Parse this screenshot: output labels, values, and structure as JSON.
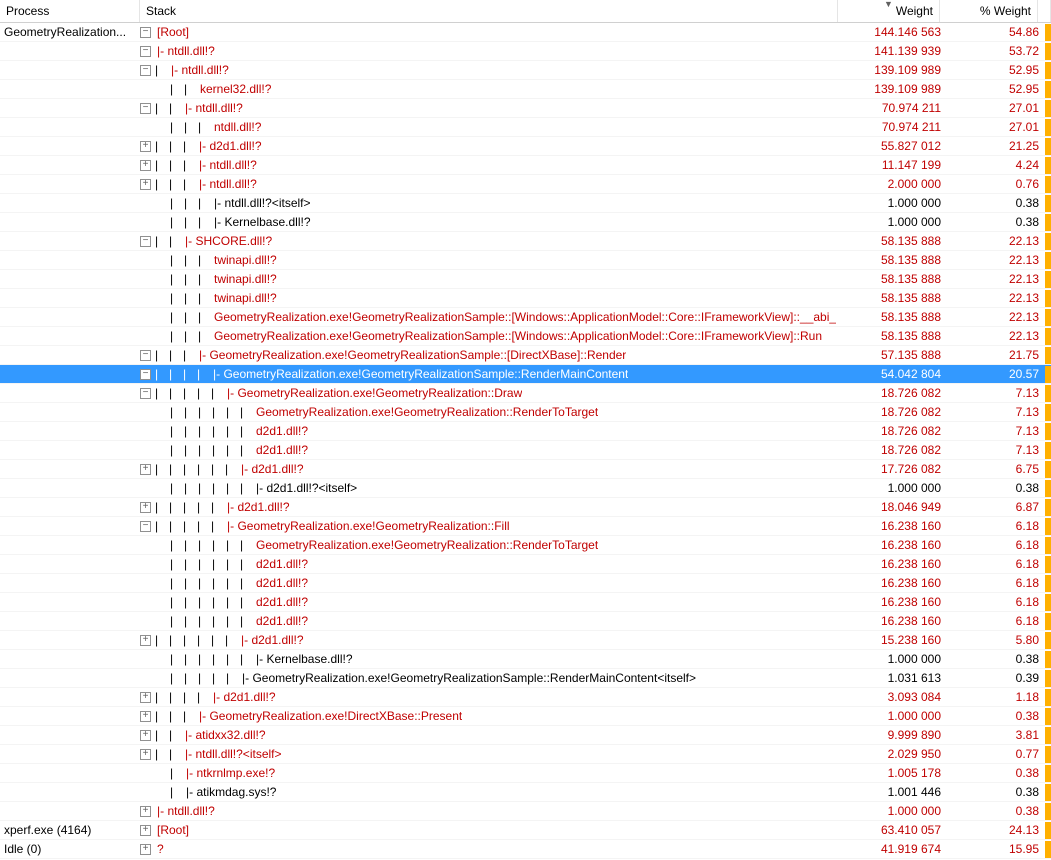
{
  "columns": {
    "process": "Process",
    "stack": "Stack",
    "weight": "Weight",
    "pweight": "% Weight"
  },
  "rows": [
    {
      "process": "GeometryRealization...",
      "expander": "-",
      "indent": 0,
      "pipes": 0,
      "label": "[Root]",
      "weight": "144.146 563",
      "pweight": "54.86",
      "color": "red",
      "bar": true
    },
    {
      "process": "",
      "expander": "-",
      "indent": 0,
      "pipes": 0,
      "label": "|- ntdll.dll!?",
      "weight": "141.139 939",
      "pweight": "53.72",
      "color": "red",
      "bar": true
    },
    {
      "process": "",
      "expander": "-",
      "indent": 0,
      "pipes": 1,
      "label": "|- ntdll.dll!?",
      "weight": "139.109 989",
      "pweight": "52.95",
      "color": "red",
      "bar": true
    },
    {
      "process": "",
      "expander": "",
      "indent": 1,
      "pipes": 2,
      "label": "kernel32.dll!?",
      "weight": "139.109 989",
      "pweight": "52.95",
      "color": "red",
      "bar": true
    },
    {
      "process": "",
      "expander": "-",
      "indent": 0,
      "pipes": 2,
      "label": "|- ntdll.dll!?",
      "weight": "70.974 211",
      "pweight": "27.01",
      "color": "red",
      "bar": true
    },
    {
      "process": "",
      "expander": "",
      "indent": 1,
      "pipes": 3,
      "label": "ntdll.dll!?",
      "weight": "70.974 211",
      "pweight": "27.01",
      "color": "red",
      "bar": true
    },
    {
      "process": "",
      "expander": "+",
      "indent": 0,
      "pipes": 3,
      "label": "|- d2d1.dll!?",
      "weight": "55.827 012",
      "pweight": "21.25",
      "color": "red",
      "bar": true
    },
    {
      "process": "",
      "expander": "+",
      "indent": 0,
      "pipes": 3,
      "label": "|- ntdll.dll!?",
      "weight": "11.147 199",
      "pweight": "4.24",
      "color": "red",
      "bar": true
    },
    {
      "process": "",
      "expander": "+",
      "indent": 0,
      "pipes": 3,
      "label": "|- ntdll.dll!?",
      "weight": "2.000 000",
      "pweight": "0.76",
      "color": "red",
      "bar": true
    },
    {
      "process": "",
      "expander": "",
      "indent": 1,
      "pipes": 3,
      "label": "|- ntdll.dll!?<itself>",
      "weight": "1.000 000",
      "pweight": "0.38",
      "color": "black",
      "bar": true
    },
    {
      "process": "",
      "expander": "",
      "indent": 1,
      "pipes": 3,
      "label": "|- Kernelbase.dll!?",
      "weight": "1.000 000",
      "pweight": "0.38",
      "color": "black",
      "bar": true
    },
    {
      "process": "",
      "expander": "-",
      "indent": 0,
      "pipes": 2,
      "label": "|- SHCORE.dll!?",
      "weight": "58.135 888",
      "pweight": "22.13",
      "color": "red",
      "bar": true
    },
    {
      "process": "",
      "expander": "",
      "indent": 1,
      "pipes": 3,
      "label": "twinapi.dll!?",
      "weight": "58.135 888",
      "pweight": "22.13",
      "color": "red",
      "bar": true
    },
    {
      "process": "",
      "expander": "",
      "indent": 1,
      "pipes": 3,
      "label": "twinapi.dll!?",
      "weight": "58.135 888",
      "pweight": "22.13",
      "color": "red",
      "bar": true
    },
    {
      "process": "",
      "expander": "",
      "indent": 1,
      "pipes": 3,
      "label": "twinapi.dll!?",
      "weight": "58.135 888",
      "pweight": "22.13",
      "color": "red",
      "bar": true
    },
    {
      "process": "",
      "expander": "",
      "indent": 1,
      "pipes": 3,
      "label": "GeometryRealization.exe!GeometryRealizationSample::[Windows::ApplicationModel::Core::IFrameworkView]::__abi_",
      "weight": "58.135 888",
      "pweight": "22.13",
      "color": "red",
      "bar": true
    },
    {
      "process": "",
      "expander": "",
      "indent": 1,
      "pipes": 3,
      "label": "GeometryRealization.exe!GeometryRealizationSample::[Windows::ApplicationModel::Core::IFrameworkView]::Run",
      "weight": "58.135 888",
      "pweight": "22.13",
      "color": "red",
      "bar": true
    },
    {
      "process": "",
      "expander": "-",
      "indent": 0,
      "pipes": 3,
      "label": "|- GeometryRealization.exe!GeometryRealizationSample::[DirectXBase]::Render",
      "weight": "57.135 888",
      "pweight": "21.75",
      "color": "red",
      "bar": true
    },
    {
      "process": "",
      "expander": "-",
      "indent": 0,
      "pipes": 4,
      "label": "|- GeometryRealization.exe!GeometryRealizationSample::RenderMainContent",
      "weight": "54.042 804",
      "pweight": "20.57",
      "color": "red",
      "bar": true,
      "selected": true
    },
    {
      "process": "",
      "expander": "-",
      "indent": 0,
      "pipes": 5,
      "label": "|- GeometryRealization.exe!GeometryRealization::Draw",
      "weight": "18.726 082",
      "pweight": "7.13",
      "color": "red",
      "bar": true
    },
    {
      "process": "",
      "expander": "",
      "indent": 1,
      "pipes": 6,
      "label": "GeometryRealization.exe!GeometryRealization::RenderToTarget",
      "weight": "18.726 082",
      "pweight": "7.13",
      "color": "red",
      "bar": true
    },
    {
      "process": "",
      "expander": "",
      "indent": 1,
      "pipes": 6,
      "label": "d2d1.dll!?",
      "weight": "18.726 082",
      "pweight": "7.13",
      "color": "red",
      "bar": true
    },
    {
      "process": "",
      "expander": "",
      "indent": 1,
      "pipes": 6,
      "label": "d2d1.dll!?",
      "weight": "18.726 082",
      "pweight": "7.13",
      "color": "red",
      "bar": true
    },
    {
      "process": "",
      "expander": "+",
      "indent": 0,
      "pipes": 6,
      "label": "|- d2d1.dll!?",
      "weight": "17.726 082",
      "pweight": "6.75",
      "color": "red",
      "bar": true
    },
    {
      "process": "",
      "expander": "",
      "indent": 1,
      "pipes": 6,
      "label": "|- d2d1.dll!?<itself>",
      "weight": "1.000 000",
      "pweight": "0.38",
      "color": "black",
      "bar": true
    },
    {
      "process": "",
      "expander": "+",
      "indent": 0,
      "pipes": 5,
      "label": "|- d2d1.dll!?",
      "weight": "18.046 949",
      "pweight": "6.87",
      "color": "red",
      "bar": true
    },
    {
      "process": "",
      "expander": "-",
      "indent": 0,
      "pipes": 5,
      "label": "|- GeometryRealization.exe!GeometryRealization::Fill",
      "weight": "16.238 160",
      "pweight": "6.18",
      "color": "red",
      "bar": true
    },
    {
      "process": "",
      "expander": "",
      "indent": 1,
      "pipes": 6,
      "label": "GeometryRealization.exe!GeometryRealization::RenderToTarget",
      "weight": "16.238 160",
      "pweight": "6.18",
      "color": "red",
      "bar": true
    },
    {
      "process": "",
      "expander": "",
      "indent": 1,
      "pipes": 6,
      "label": "d2d1.dll!?",
      "weight": "16.238 160",
      "pweight": "6.18",
      "color": "red",
      "bar": true
    },
    {
      "process": "",
      "expander": "",
      "indent": 1,
      "pipes": 6,
      "label": "d2d1.dll!?",
      "weight": "16.238 160",
      "pweight": "6.18",
      "color": "red",
      "bar": true
    },
    {
      "process": "",
      "expander": "",
      "indent": 1,
      "pipes": 6,
      "label": "d2d1.dll!?",
      "weight": "16.238 160",
      "pweight": "6.18",
      "color": "red",
      "bar": true
    },
    {
      "process": "",
      "expander": "",
      "indent": 1,
      "pipes": 6,
      "label": "d2d1.dll!?",
      "weight": "16.238 160",
      "pweight": "6.18",
      "color": "red",
      "bar": true
    },
    {
      "process": "",
      "expander": "+",
      "indent": 0,
      "pipes": 6,
      "label": "|- d2d1.dll!?",
      "weight": "15.238 160",
      "pweight": "5.80",
      "color": "red",
      "bar": true
    },
    {
      "process": "",
      "expander": "",
      "indent": 1,
      "pipes": 6,
      "label": "|- Kernelbase.dll!?",
      "weight": "1.000 000",
      "pweight": "0.38",
      "color": "black",
      "bar": true
    },
    {
      "process": "",
      "expander": "",
      "indent": 1,
      "pipes": 5,
      "label": "|- GeometryRealization.exe!GeometryRealizationSample::RenderMainContent<itself>",
      "weight": "1.031 613",
      "pweight": "0.39",
      "color": "black",
      "bar": true
    },
    {
      "process": "",
      "expander": "+",
      "indent": 0,
      "pipes": 4,
      "label": "|- d2d1.dll!?",
      "weight": "3.093 084",
      "pweight": "1.18",
      "color": "red",
      "bar": true
    },
    {
      "process": "",
      "expander": "+",
      "indent": 0,
      "pipes": 3,
      "label": "|- GeometryRealization.exe!DirectXBase::Present",
      "weight": "1.000 000",
      "pweight": "0.38",
      "color": "red",
      "bar": true
    },
    {
      "process": "",
      "expander": "+",
      "indent": 0,
      "pipes": 2,
      "label": "|- atidxx32.dll!?",
      "weight": "9.999 890",
      "pweight": "3.81",
      "color": "red",
      "bar": true
    },
    {
      "process": "",
      "expander": "+",
      "indent": 0,
      "pipes": 2,
      "label": "|- ntdll.dll!?<itself>",
      "weight": "2.029 950",
      "pweight": "0.77",
      "color": "red",
      "bar": true
    },
    {
      "process": "",
      "expander": "",
      "indent": 1,
      "pipes": 1,
      "label": "|- ntkrnlmp.exe!?",
      "weight": "1.005 178",
      "pweight": "0.38",
      "color": "red",
      "bar": true
    },
    {
      "process": "",
      "expander": "",
      "indent": 1,
      "pipes": 1,
      "label": "|- atikmdag.sys!?",
      "weight": "1.001 446",
      "pweight": "0.38",
      "color": "black",
      "bar": true
    },
    {
      "process": "",
      "expander": "+",
      "indent": 0,
      "pipes": 0,
      "label": "|- ntdll.dll!?",
      "weight": "1.000 000",
      "pweight": "0.38",
      "color": "red",
      "bar": true
    },
    {
      "process": "xperf.exe (4164)",
      "expander": "+",
      "indent": 0,
      "pipes": 0,
      "label": "[Root]",
      "weight": "63.410 057",
      "pweight": "24.13",
      "color": "red",
      "bar": true
    },
    {
      "process": "Idle (0)",
      "expander": "+",
      "indent": 0,
      "pipes": 0,
      "label": "?",
      "weight": "41.919 674",
      "pweight": "15.95",
      "color": "red",
      "bar": true
    }
  ]
}
